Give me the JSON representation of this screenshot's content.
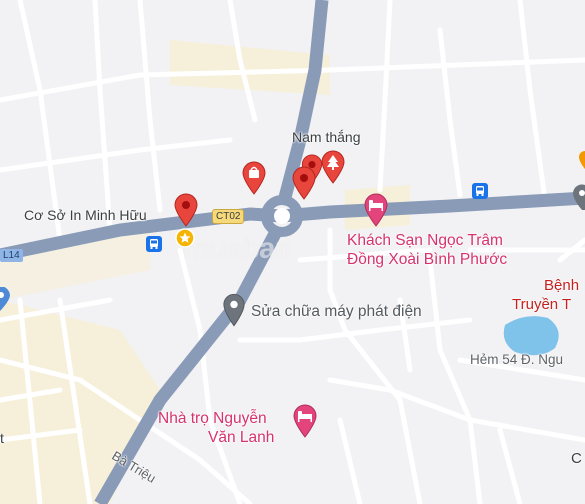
{
  "map": {
    "colors": {
      "background": "#f2f2f4",
      "major_road": "#8a9bb8",
      "minor_road": "#ffffff",
      "built_up": "#f6efd9",
      "water": "#7fc2ea",
      "pin_red": "#e8453c",
      "pin_gray": "#6d747c",
      "pink_label": "#d6336c"
    },
    "route_shields": {
      "ct02": "CT02",
      "l14": "L14"
    },
    "roads": {
      "ba_trieu": "Bà Triệu",
      "hem_54": "Hẻm 54 Đ. Ngu"
    },
    "places": {
      "co_so_in": "Cơ Sở In Minh Hữu",
      "nam_thang": "Nam thắng",
      "sua_chua": "Sửa chữa máy phát điện",
      "khach_san_line1": "Khách Sạn Ngọc Trâm",
      "khach_san_line2": "Đồng Xoài Bình Phước",
      "nha_tro_line1": "Nhà trọ Nguyễn",
      "nha_tro_line2": "Văn Lanh",
      "benh_line1": "Bệnh",
      "benh_line2": "Truyền T",
      "edge_c": "C",
      "edge_t": "t"
    },
    "icons": {
      "pin_co_so": "map-pin-red-icon",
      "pin_nam_thang_1": "map-pin-red-icon",
      "pin_nam_thang_2": "map-pin-red-icon",
      "pin_shop": "shopping-bag-pin-icon",
      "pin_park": "tree-pin-icon",
      "pin_repair": "map-pin-gray-icon",
      "hotel_1": "hotel-bed-icon",
      "hotel_2": "hotel-bed-icon",
      "bus_1": "bus-stop-icon",
      "bus_2": "bus-stop-icon",
      "saved_star": "saved-star-icon",
      "roundabout": "roundabout-icon",
      "partial_pin_left": "map-pin-blue-icon",
      "partial_pin_right": "map-pin-gray-icon"
    },
    "watermark": "muaban"
  }
}
